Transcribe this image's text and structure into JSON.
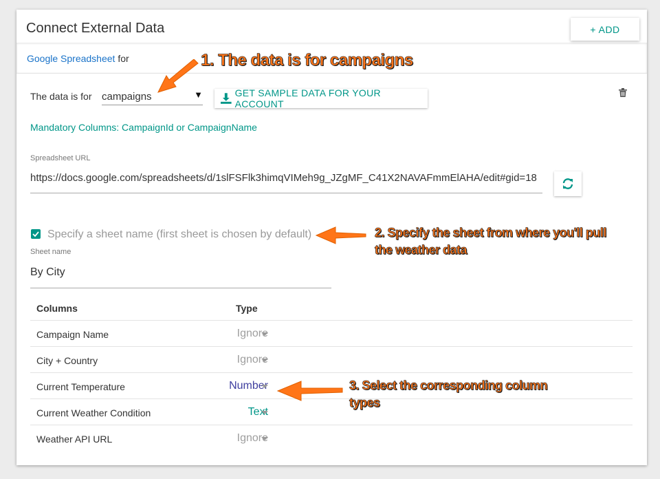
{
  "card": {
    "title": "Connect External Data",
    "add_label": "+ ADD"
  },
  "source": {
    "link_text": "Google Spreadsheet",
    "suffix": "for"
  },
  "data_for": {
    "label": "The data is for",
    "selected": "campaigns",
    "sample_button": "GET SAMPLE DATA FOR YOUR ACCOUNT"
  },
  "mandatory_columns": "Mandatory Columns: CampaignId or CampaignName",
  "spreadsheet": {
    "label": "Spreadsheet URL",
    "value": "https://docs.google.com/spreadsheets/d/1slFSFlk3himqVIMeh9g_JZgMF_C41X2NAVAFmmElAHA/edit#gid=18"
  },
  "sheet_option": {
    "checked": true,
    "label": "Specify a sheet name (first sheet is chosen by default)"
  },
  "sheet": {
    "label": "Sheet name",
    "value": "By City"
  },
  "columns": {
    "headers": [
      "Columns",
      "Type"
    ],
    "rows": [
      {
        "name": "Campaign Name",
        "type": "Ignore",
        "color": "#9e9e9e"
      },
      {
        "name": "City + Country",
        "type": "Ignore",
        "color": "#9e9e9e"
      },
      {
        "name": "Current Temperature",
        "type": "Number",
        "color": "#3f3f9f"
      },
      {
        "name": "Current Weather Condition",
        "type": "Text",
        "color": "#009688"
      },
      {
        "name": "Weather API URL",
        "type": "Ignore",
        "color": "#9e9e9e"
      }
    ]
  },
  "annotations": {
    "a1": "1. The data is for campaigns",
    "a2": "2. Specify the sheet from where you'll pull the weather data",
    "a3": "3. Select the corresponding column types"
  },
  "colors": {
    "accent": "#009688",
    "link": "#1a73c9",
    "annotation": "#ff7518"
  }
}
